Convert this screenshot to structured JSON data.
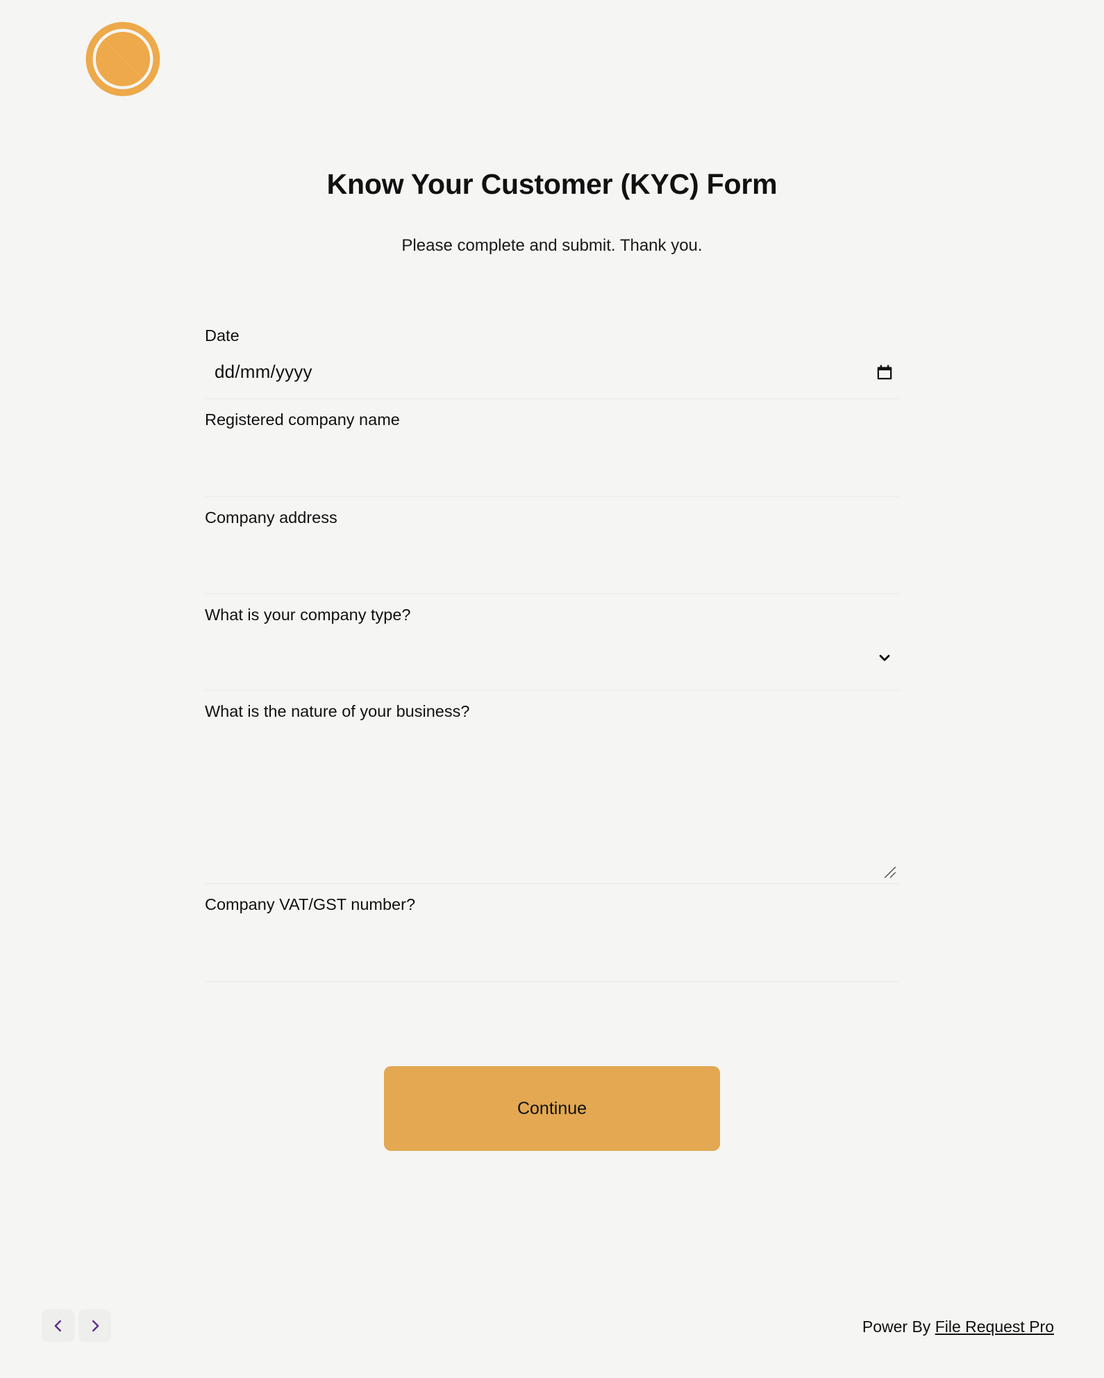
{
  "brand": {
    "logo_icon": "orange-slice-logo",
    "logo_color": "#eda94a"
  },
  "header": {
    "title": "Know Your Customer (KYC) Form",
    "subtitle": "Please complete and submit. Thank you."
  },
  "form": {
    "fields": [
      {
        "id": "date",
        "label": "Date",
        "type": "date",
        "value": "",
        "placeholder": "dd/mm/yyyy",
        "icon": "calendar-icon"
      },
      {
        "id": "registered-company-name",
        "label": "Registered company name",
        "type": "text",
        "value": "",
        "placeholder": ""
      },
      {
        "id": "company-address",
        "label": "Company address",
        "type": "text",
        "value": "",
        "placeholder": ""
      },
      {
        "id": "company-type",
        "label": "What is your company type?",
        "type": "select",
        "value": "",
        "icon": "chevron-down-icon"
      },
      {
        "id": "nature-of-business",
        "label": "What is the nature of your business?",
        "type": "textarea",
        "value": "",
        "placeholder": ""
      },
      {
        "id": "vat-gst-number",
        "label": "Company VAT/GST number?",
        "type": "text",
        "value": "",
        "placeholder": ""
      }
    ],
    "submit_label": "Continue",
    "submit_color": "#e3a851"
  },
  "footer": {
    "prev_icon": "chevron-left-icon",
    "next_icon": "chevron-right-icon",
    "nav_color": "#5b2d8e",
    "credit_prefix": "Power By ",
    "credit_link": "File Request Pro"
  }
}
